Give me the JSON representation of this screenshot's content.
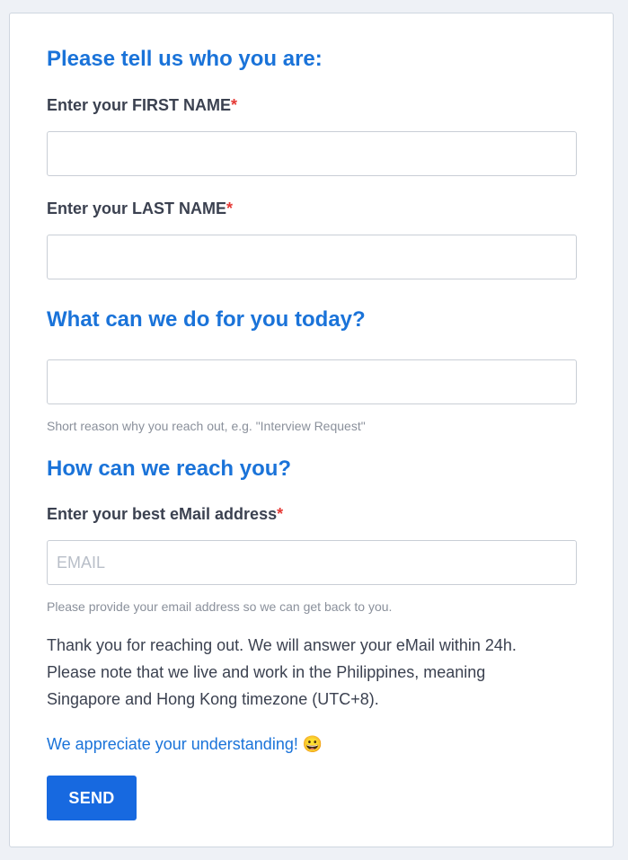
{
  "section_who": {
    "heading": "Please tell us who you are:",
    "first_name_label": "Enter your FIRST NAME",
    "first_name_value": "",
    "last_name_label": "Enter your LAST NAME",
    "last_name_value": "",
    "required_marker": "*"
  },
  "section_what": {
    "heading": "What can we do for you today?",
    "reason_value": "",
    "help_text": "Short reason why you reach out, e.g. \"Interview Request\""
  },
  "section_reach": {
    "heading": "How can we reach you?",
    "email_label": "Enter your best eMail address",
    "email_placeholder": "EMAIL",
    "email_value": "",
    "help_text": "Please provide your email address so we can get back to you."
  },
  "message": {
    "line1": "Thank you for reaching out. We will answer your eMail within 24h.",
    "line2": "Please note that we live and work in the Philippines, meaning",
    "line3": "Singapore and Hong Kong timezone (UTC+8).",
    "appreciation": "We appreciate your understanding! 😀"
  },
  "actions": {
    "send_label": "SEND"
  },
  "colors": {
    "accent": "#1a73d9",
    "button": "#1769e0",
    "required": "#e53935",
    "text": "#3b4150",
    "muted": "#8a909b",
    "page_background": "#eef1f6"
  }
}
